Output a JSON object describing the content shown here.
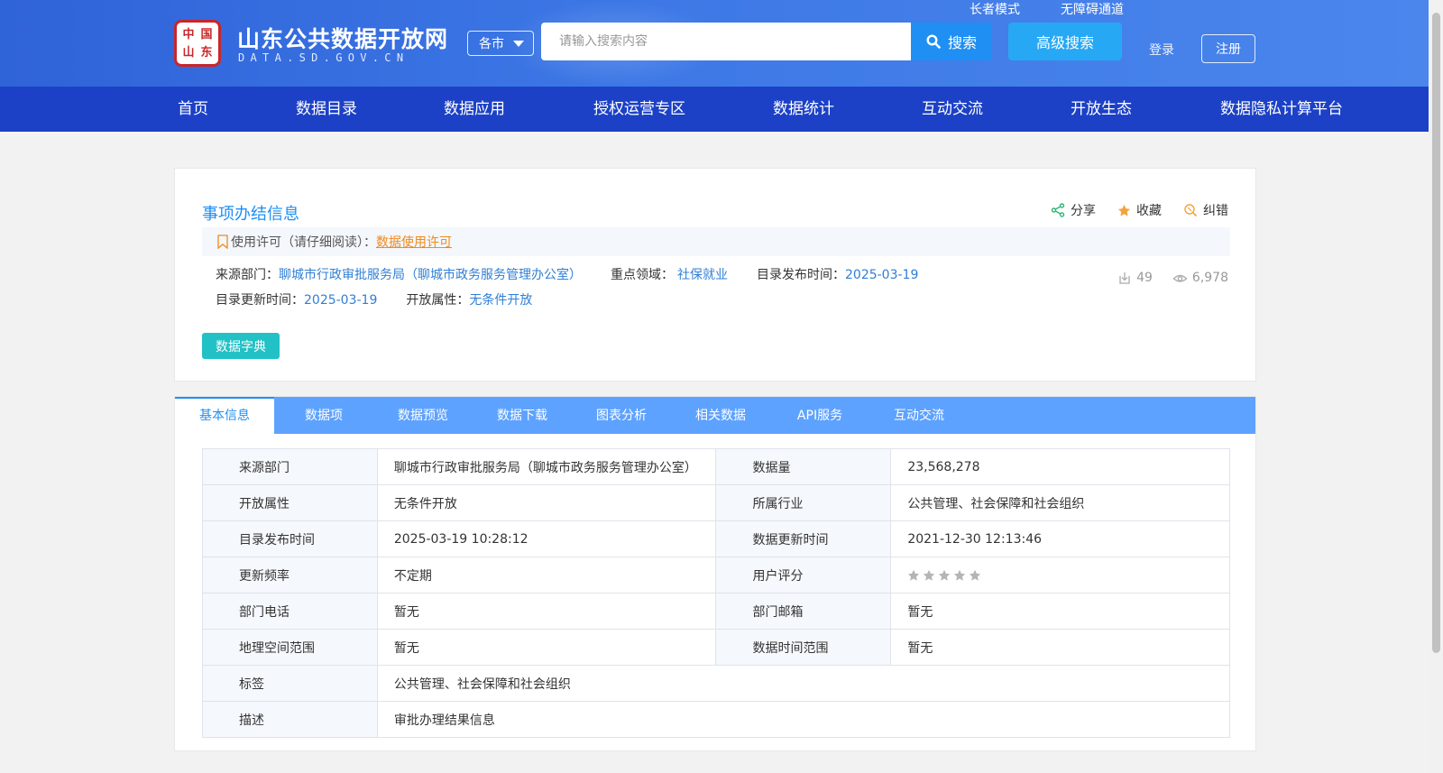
{
  "header": {
    "logo_seal_chars": [
      "中",
      "国",
      "山",
      "东"
    ],
    "site_title": "山东公共数据开放网",
    "site_domain": "DATA.SD.GOV.CN",
    "city_select": "各市",
    "search_placeholder": "请输入搜索内容",
    "search_button": "搜索",
    "advanced_search": "高级搜索",
    "elder_mode": "长者模式",
    "accessibility": "无障碍通道",
    "login": "登录",
    "register": "注册"
  },
  "nav": [
    "首页",
    "数据目录",
    "数据应用",
    "授权运营专区",
    "数据统计",
    "互动交流",
    "开放生态",
    "数据隐私计算平台"
  ],
  "dataset": {
    "title": "事项办结信息",
    "actions": {
      "share": "分享",
      "favorite": "收藏",
      "correct": "纠错"
    },
    "license_label": "使用许可（请仔细阅读）：",
    "license_link": "数据使用许可",
    "meta": {
      "source_label": "来源部门：",
      "source_value": "聊城市行政审批服务局（聊城市政务服务管理办公室）",
      "domain_label": "重点领域：",
      "domain_value": "社保就业",
      "publish_label": "目录发布时间：",
      "publish_value": "2025-03-19",
      "update_label": "目录更新时间：",
      "update_value": "2025-03-19",
      "open_label": "开放属性：",
      "open_value": "无条件开放"
    },
    "downloads": "49",
    "views": "6,978",
    "dict_button": "数据字典"
  },
  "tabs": [
    "基本信息",
    "数据项",
    "数据预览",
    "数据下载",
    "图表分析",
    "相关数据",
    "API服务",
    "互动交流"
  ],
  "info_table": {
    "rows": [
      [
        "来源部门",
        "聊城市行政审批服务局（聊城市政务服务管理办公室）",
        "数据量",
        "23,568,278"
      ],
      [
        "开放属性",
        "无条件开放",
        "所属行业",
        "公共管理、社会保障和社会组织"
      ],
      [
        "目录发布时间",
        "2025-03-19 10:28:12",
        "数据更新时间",
        "2021-12-30 12:13:46"
      ],
      [
        "更新频率",
        "不定期",
        "用户评分",
        ""
      ],
      [
        "部门电话",
        "暂无",
        "部门邮箱",
        "暂无"
      ],
      [
        "地理空间范围",
        "暂无",
        "数据时间范围",
        "暂无"
      ]
    ],
    "wide_rows": [
      [
        "标签",
        "公共管理、社会保障和社会组织"
      ],
      [
        "描述",
        "审批办理结果信息"
      ]
    ],
    "rating_stars": 0,
    "rating_max": 5
  },
  "colors": {
    "header_blue": "#3d78e6",
    "nav_blue": "#1c41c6",
    "link_blue": "#2f7fd6",
    "tab_blue": "#5ea2ff",
    "teal": "#21c1c5",
    "license_orange": "#f08a1c"
  }
}
